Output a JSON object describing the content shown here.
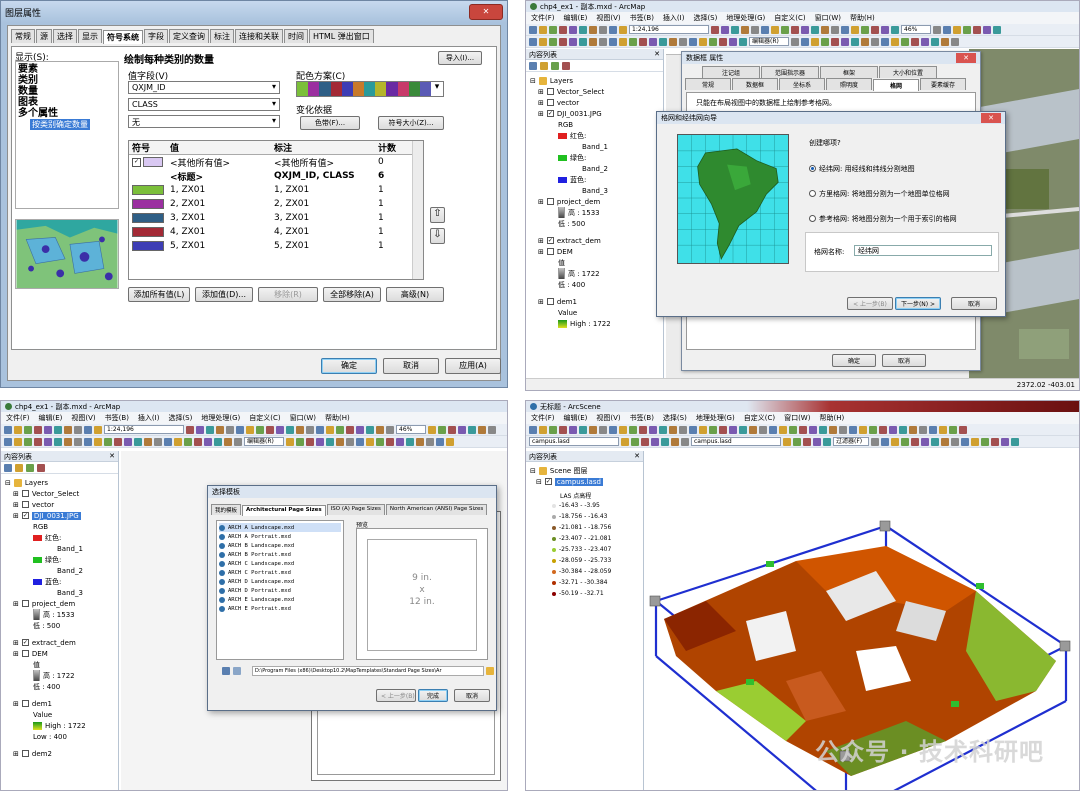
{
  "q1": {
    "title": "图层属性",
    "tabs": [
      "常规",
      "源",
      "选择",
      "显示",
      "符号系统",
      "字段",
      "定义查询",
      "标注",
      "连接和关联",
      "时间",
      "HTML 弹出窗口"
    ],
    "show_label": "显示(S):",
    "tree": [
      "要素",
      "类别",
      "数量",
      "图表",
      "多个属性",
      "按类别确定数量"
    ],
    "heading": "绘制每种类别的数量",
    "import_btn": "导入(I)...",
    "value_field_label": "值字段(V)",
    "fields": [
      "QXJM_ID",
      "CLASS",
      "无"
    ],
    "color_scheme_label": "配色方案(C)",
    "variation_label": "变化依据",
    "color_ramp_btn": "色带(F)...",
    "symbol_size_btn": "符号大小(Z)...",
    "table_headers": [
      "符号",
      "值",
      "标注",
      "计数"
    ],
    "rows": [
      {
        "value": "<其他所有值>",
        "label": "<其他所有值>",
        "count": "0",
        "color": "#d9c8f2"
      },
      {
        "value": "<标题>",
        "label": "QXJM_ID, CLASS",
        "count": "6",
        "color": ""
      },
      {
        "value": "1, ZX01",
        "label": "1, ZX01",
        "count": "1",
        "color": "#7bbf3a"
      },
      {
        "value": "2, ZX01",
        "label": "2, ZX01",
        "count": "1",
        "color": "#9b2fa0"
      },
      {
        "value": "3, ZX01",
        "label": "3, ZX01",
        "count": "1",
        "color": "#2f5f86"
      },
      {
        "value": "4, ZX01",
        "label": "4, ZX01",
        "count": "1",
        "color": "#a32a36"
      },
      {
        "value": "5, ZX01",
        "label": "5, ZX01",
        "count": "1",
        "color": "#3d3db5"
      }
    ],
    "buttons": [
      "添加所有值(L)",
      "添加值(D)...",
      "移除(R)",
      "全部移除(A)",
      "高级(N)"
    ],
    "ok": "确定",
    "cancel": "取消",
    "apply": "应用(A)"
  },
  "q2": {
    "title": "chp4_ex1 - 副本.mxd - ArcMap",
    "menu": [
      "文件(F)",
      "编辑(E)",
      "视图(V)",
      "书签(B)",
      "插入(I)",
      "选择(S)",
      "地理处理(G)",
      "自定义(C)",
      "窗口(W)",
      "帮助(H)"
    ],
    "scale": "1:24,196",
    "zoom": "46%",
    "editor": "编辑器(R)",
    "toc_title": "内容列表",
    "layers": [
      "Layers",
      "Vector_Select",
      "vector",
      "DJI_0031.JPG",
      "RGB",
      "红色:",
      "Band_1",
      "绿色:",
      "Band_2",
      "蓝色:",
      "Band_3",
      "project_dem",
      "高 : 1533",
      "低 : 500",
      "extract_dem",
      "DEM",
      "值",
      "高 : 1722",
      "低 : 400",
      "dem1",
      "Value",
      "High : 1722"
    ],
    "frame_title": "数据框 属性",
    "frame_tabs_row1": [
      "注记组",
      "范围指示器",
      "框架",
      "大小和位置"
    ],
    "frame_tabs_row2": [
      "常规",
      "数据框",
      "坐标系",
      "照明度",
      "格网",
      "要素缓存"
    ],
    "frame_text": "只能在布局视图中的数据框上绘制参考格网。",
    "wizard_title": "格网和经纬网向导",
    "wizard_q": "创建哪项?",
    "options": [
      "经纬网: 用经线和纬线分割地图",
      "方里格网: 将地图分割为一个地图单位格网",
      "参考格网: 将地图分割为一个用于索引的格网"
    ],
    "grid_name_label": "格网名称:",
    "grid_name": "经纬网",
    "back": "< 上一步(B)",
    "next": "下一步(N) >",
    "cancel": "取消",
    "ok": "确定",
    "cancel2": "取消",
    "coords": "2372.02  -403.01"
  },
  "q3": {
    "title": "chp4_ex1 - 副本.mxd - ArcMap",
    "dialog_title": "选择模板",
    "tabs": [
      "我的模板",
      "Architectural Page Sizes",
      "ISO (A) Page Sizes",
      "North American (ANSI) Page Sizes"
    ],
    "templates": [
      "ARCH A Landscape.mxd",
      "ARCH A Portrait.mxd",
      "ARCH B Landscape.mxd",
      "ARCH B Portrait.mxd",
      "ARCH C Landscape.mxd",
      "ARCH C Portrait.mxd",
      "ARCH D Landscape.mxd",
      "ARCH D Portrait.mxd",
      "ARCH E Landscape.mxd",
      "ARCH E Portrait.mxd"
    ],
    "preview_label": "预览",
    "preview_w": "9 in.",
    "preview_x": "x",
    "preview_h": "12 in.",
    "path": "D:\\Program Files (x86)\\Desktop10.2\\MapTemplates\\Standard Page Sizes\\Ar",
    "back": "< 上一步(B)",
    "finish": "完成",
    "cancel": "取消",
    "layers": [
      "Layers",
      "Vector_Select",
      "vector",
      "DJI_0031.JPG",
      "RGB",
      "红色:",
      "Band_1",
      "绿色:",
      "Band_2",
      "蓝色:",
      "Band_3",
      "project_dem",
      "高 : 1533",
      "低 : 500",
      "extract_dem",
      "DEM",
      "值",
      "高 : 1722",
      "低 : 400",
      "dem1",
      "Value",
      "High : 1722",
      "Low : 400",
      "dem2"
    ]
  },
  "q4": {
    "title": "无标题 - ArcScene",
    "menu": [
      "文件(F)",
      "编辑(E)",
      "视图(V)",
      "书签(B)",
      "选择(S)",
      "地理处理(G)",
      "自定义(C)",
      "窗口(W)",
      "帮助(H)"
    ],
    "combo1": "campus.lasd",
    "combo2": "campus.lasd",
    "filter": "过滤器(F)",
    "toc_title": "内容列表",
    "scene_layers": "Scene 图层",
    "layer": "campus.lasd",
    "legend_title": "LAS 点高程",
    "legend": [
      {
        "label": "-16.43 - -3.95",
        "color": "#e3e3e3"
      },
      {
        "label": "-18.756 - -16.43",
        "color": "#aaaaaa"
      },
      {
        "label": "-21.081 - -18.756",
        "color": "#8a5a2a"
      },
      {
        "label": "-23.407 - -21.081",
        "color": "#6b8e23"
      },
      {
        "label": "-25.733 - -23.407",
        "color": "#9acd32"
      },
      {
        "label": "-28.059 - -25.733",
        "color": "#c8a000"
      },
      {
        "label": "-30.384 - -28.059",
        "color": "#d2691e"
      },
      {
        "label": "-32.71 - -30.384",
        "color": "#b03000"
      },
      {
        "label": "-50.19 - -32.71",
        "color": "#8b0000"
      }
    ]
  },
  "watermark": "公众号 · 技术科研吧"
}
